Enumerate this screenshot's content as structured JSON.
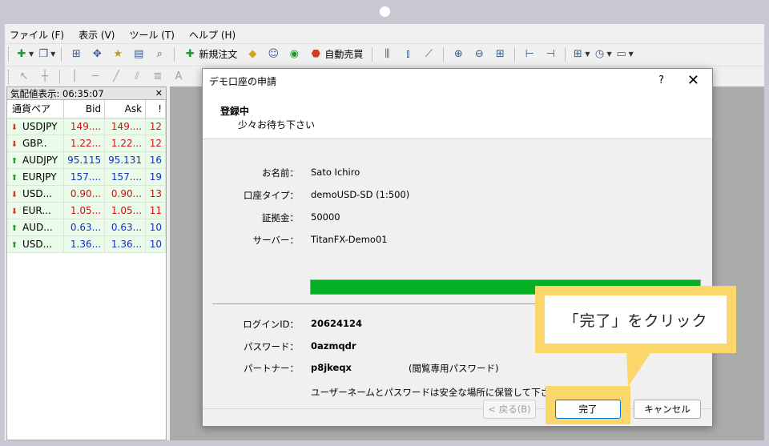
{
  "menu": [
    "ファイル (F)",
    "表示 (V)",
    "ツール (T)",
    "ヘルプ (H)"
  ],
  "toolbar": {
    "new_order": "新規注文",
    "auto_trade": "自動売買",
    "font_a": "A"
  },
  "market_watch": {
    "title": "気配値表示: 06:35:07",
    "columns": [
      "通貨ペア",
      "Bid",
      "Ask",
      "!"
    ],
    "rows": [
      {
        "symbol": "USDJPY",
        "bid": "149....",
        "ask": "149....",
        "n": "12",
        "dir": "down",
        "color": "red"
      },
      {
        "symbol": "GBP..",
        "bid": "1.22...",
        "ask": "1.22...",
        "n": "12",
        "dir": "down",
        "color": "red"
      },
      {
        "symbol": "AUDJPY",
        "bid": "95.115",
        "ask": "95.131",
        "n": "16",
        "dir": "up",
        "color": "blue"
      },
      {
        "symbol": "EURJPY",
        "bid": "157....",
        "ask": "157....",
        "n": "19",
        "dir": "up",
        "color": "blue"
      },
      {
        "symbol": "USD...",
        "bid": "0.90...",
        "ask": "0.90...",
        "n": "13",
        "dir": "down",
        "color": "red"
      },
      {
        "symbol": "EUR...",
        "bid": "1.05...",
        "ask": "1.05...",
        "n": "11",
        "dir": "down",
        "color": "red"
      },
      {
        "symbol": "AUD...",
        "bid": "0.63...",
        "ask": "0.63...",
        "n": "10",
        "dir": "up",
        "color": "blue"
      },
      {
        "symbol": "USD...",
        "bid": "1.36...",
        "ask": "1.36...",
        "n": "10",
        "dir": "up",
        "color": "blue"
      }
    ]
  },
  "dialog": {
    "title": "デモ口座の申請",
    "help": "?",
    "close": "✕",
    "header_title": "登録中",
    "header_sub": "少々お待ち下さい",
    "fields": [
      {
        "label": "お名前：",
        "value": "Sato Ichiro"
      },
      {
        "label": "口座タイプ：",
        "value": "demoUSD-SD (1:500)"
      },
      {
        "label": "証拠金：",
        "value": "50000"
      },
      {
        "label": "サーバー：",
        "value": "TitanFX-Demo01"
      }
    ],
    "progress": 1.0,
    "credentials": [
      {
        "label": "ログインID：",
        "value": "20624124"
      },
      {
        "label": "パスワード：",
        "value": "0azmqdr"
      },
      {
        "label": "パートナー：",
        "value": "p8jkeqx",
        "note": "(閲覧専用パスワード)"
      }
    ],
    "notice": "ユーザーネームとパスワードは安全な場所に保管して下さい。",
    "buttons": {
      "back": "< 戻る(B)",
      "finish": "完了",
      "cancel": "キャンセル"
    }
  },
  "callout": {
    "text": "「完了」をクリック"
  },
  "colors": {
    "progress": "#06b025",
    "highlight": "#fbd66a",
    "bid_down": "#d01010",
    "bid_up": "#1430c8"
  }
}
